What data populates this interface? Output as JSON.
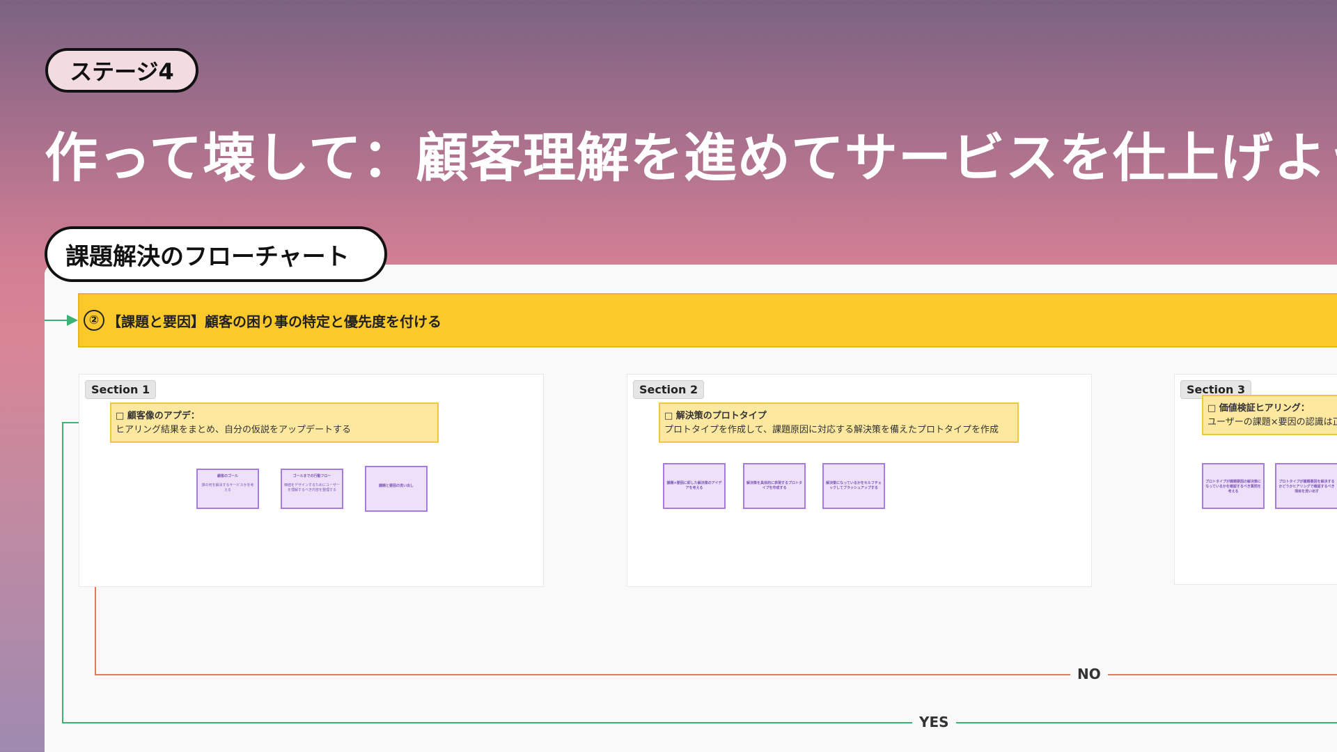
{
  "header": {
    "stage_label": "ステージ4",
    "title": "作って壊して：顧客理解を進めてサービスを仕上げよう"
  },
  "flowchart": {
    "title": "課題解決のフローチャート",
    "banner_num": "②",
    "banner_text": "【課題と要因】顧客の困り事の特定と優先度を付ける",
    "no_label": "NO",
    "yes_label": "YES",
    "colors": {
      "banner": "#fcc92a",
      "task": "#fde8a0",
      "box": "#efe0fa",
      "no_line": "#e07a5f",
      "yes_line": "#3bb273"
    }
  },
  "sections": [
    {
      "label": "Section 1",
      "task_title": "□ 顧客像のアプデ：",
      "task_desc": "ヒアリング結果をまとめ、自分の仮説をアップデートする",
      "boxes": [
        {
          "title": "顧客のゴール",
          "body": "誰の何を解決するサービスかを考える"
        },
        {
          "title": "ゴールまでの行動フロー",
          "body": "価値をデザインするためにユーザーを理解するべき内容を整理する"
        },
        {
          "title": "課題と要因の洗い出し",
          "body": ""
        }
      ]
    },
    {
      "label": "Section 2",
      "task_title": "□ 解決策のプロトタイプ",
      "task_desc": "プロトタイプを作成して、課題原因に対応する解決策を備えたプロトタイプを作成",
      "boxes": [
        {
          "title": "課題×要因に即した解決策のアイデアを考える",
          "body": ""
        },
        {
          "title": "解決策を具体的に表現するプロトタイプを作成する",
          "body": ""
        },
        {
          "title": "解決策になっているかをセルフチェックしてブラッシュアップする",
          "body": ""
        }
      ]
    },
    {
      "label": "Section 3",
      "task_title": "□ 価値検証ヒアリング：",
      "task_desc": "ユーザーの課題×要因の認識は正",
      "boxes": [
        {
          "title": "プロトタイプが課題要因の解決策になっているかを確認するべき質問を考える",
          "body": ""
        },
        {
          "title": "プロトタイプが課題要因を解決するかどうかヒアリングで確認するべき項目を洗い出す",
          "body": ""
        }
      ]
    }
  ]
}
